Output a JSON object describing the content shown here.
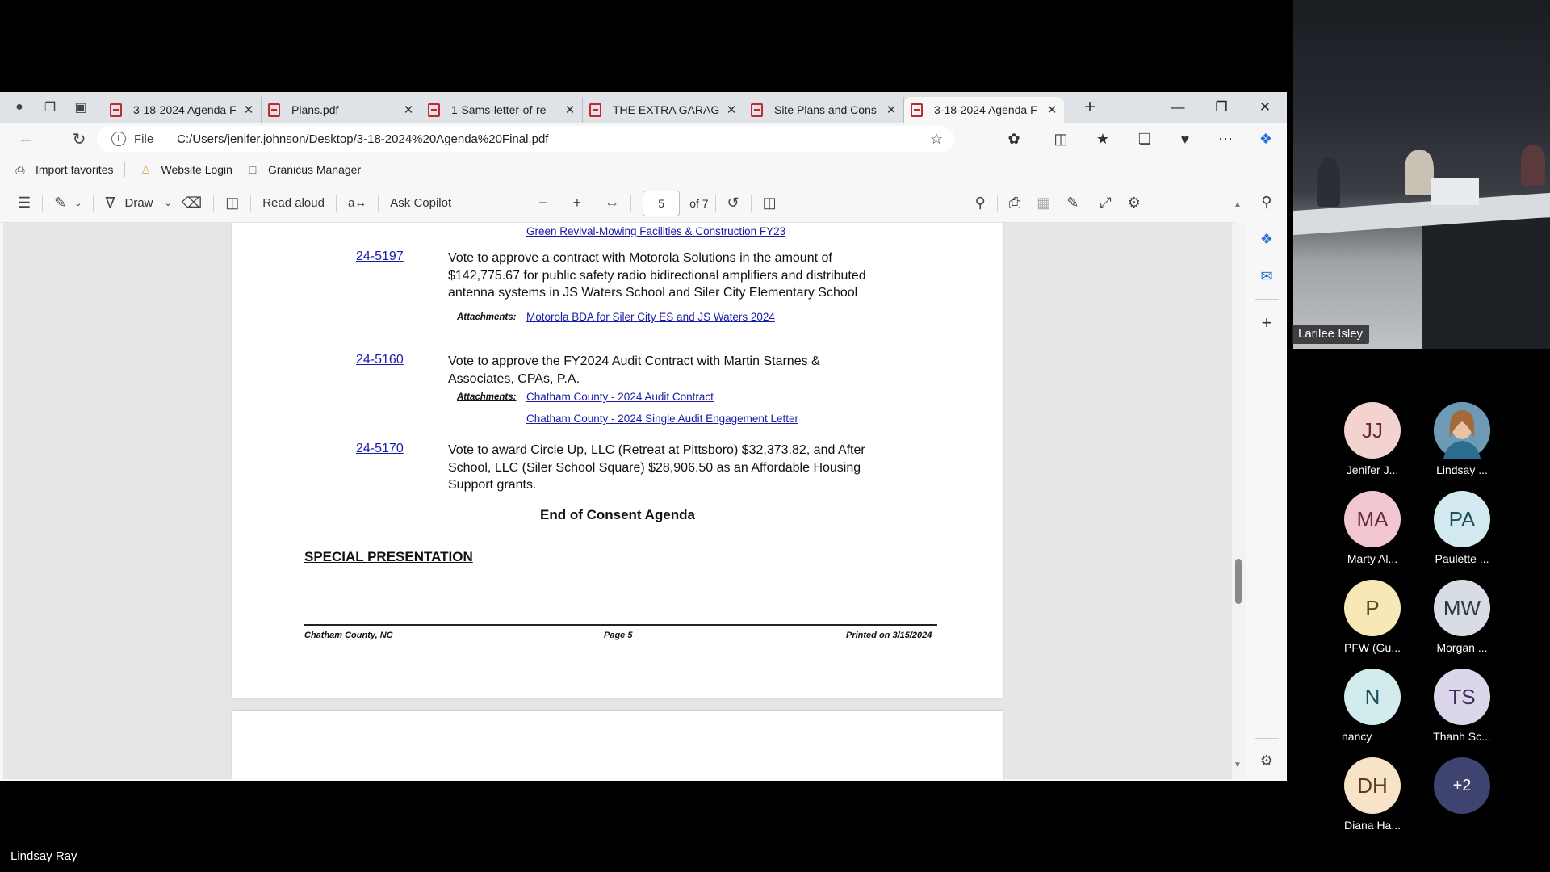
{
  "browser": {
    "tabs": [
      {
        "label": "3-18-2024 Agenda F",
        "active": false
      },
      {
        "label": "Plans.pdf",
        "active": false
      },
      {
        "label": "1-Sams-letter-of-re",
        "active": false
      },
      {
        "label": "THE EXTRA GARAGE",
        "active": false
      },
      {
        "label": "Site Plans and Cons",
        "active": false
      },
      {
        "label": "3-18-2024 Agenda F",
        "active": true
      }
    ],
    "address": {
      "file_label": "File",
      "url": "C:/Users/jenifer.johnson/Desktop/3-18-2024%20Agenda%20Final.pdf"
    },
    "favorites": [
      {
        "label": "Import favorites"
      },
      {
        "label": "Website Login"
      },
      {
        "label": "Granicus Manager"
      }
    ]
  },
  "pdf_toolbar": {
    "draw_label": "Draw",
    "read_aloud_label": "Read aloud",
    "ask_copilot_label": "Ask Copilot",
    "page_current": "5",
    "page_of": "of 7"
  },
  "document": {
    "top_link": "Green Revival-Mowing Facilities & Construction FY23",
    "items": [
      {
        "id": "24-5197",
        "text": "Vote to approve a contract with Motorola Solutions in the amount of $142,775.67 for public safety radio bidirectional amplifiers and distributed antenna systems in JS Waters School and Siler City Elementary School",
        "attachments": [
          "Motorola BDA for Siler City ES and JS Waters 2024"
        ]
      },
      {
        "id": "24-5160",
        "text": "Vote to approve the FY2024 Audit Contract with Martin Starnes & Associates, CPAs, P.A.",
        "attachments": [
          "Chatham County - 2024 Audit Contract",
          "Chatham County - 2024 Single Audit Engagement Letter"
        ]
      },
      {
        "id": "24-5170",
        "text": "Vote to award Circle Up, LLC (Retreat at Pittsboro) $32,373.82, and After School, LLC (Siler School Square) $28,906.50 as an Affordable Housing Support grants.",
        "attachments": []
      }
    ],
    "attachments_label": "Attachments:",
    "end_consent": "End of Consent Agenda",
    "special_presentation": "SPECIAL PRESENTATION",
    "footer": {
      "left": "Chatham County, NC",
      "center": "Page 5",
      "right": "Printed on 3/15/2024"
    }
  },
  "meeting": {
    "active_speaker": "Larilee Isley",
    "participants": [
      {
        "initials": "JJ",
        "name": "Jenifer J...",
        "color": "#f3d3cf"
      },
      {
        "initials": "",
        "name": "Lindsay ...",
        "color": "#5f8fae"
      },
      {
        "initials": "MA",
        "name": "Marty Al...",
        "color": "#f2c7d2"
      },
      {
        "initials": "PA",
        "name": "Paulette ...",
        "color": "#d2e9ef"
      },
      {
        "initials": "P",
        "name": "PFW (Gu...",
        "color": "#f8e8b8"
      },
      {
        "initials": "MW",
        "name": "Morgan ...",
        "color": "#d7dde3"
      },
      {
        "initials": "N",
        "name": "nancy",
        "color": "#d2ecee"
      },
      {
        "initials": "TS",
        "name": "Thanh Sc...",
        "color": "#dcd6ea"
      },
      {
        "initials": "DH",
        "name": "Diana Ha...",
        "color": "#f6e3c8"
      },
      {
        "initials": "+2",
        "name": "",
        "color": "#3e4370"
      }
    ],
    "self_name": "Lindsay Ray"
  }
}
